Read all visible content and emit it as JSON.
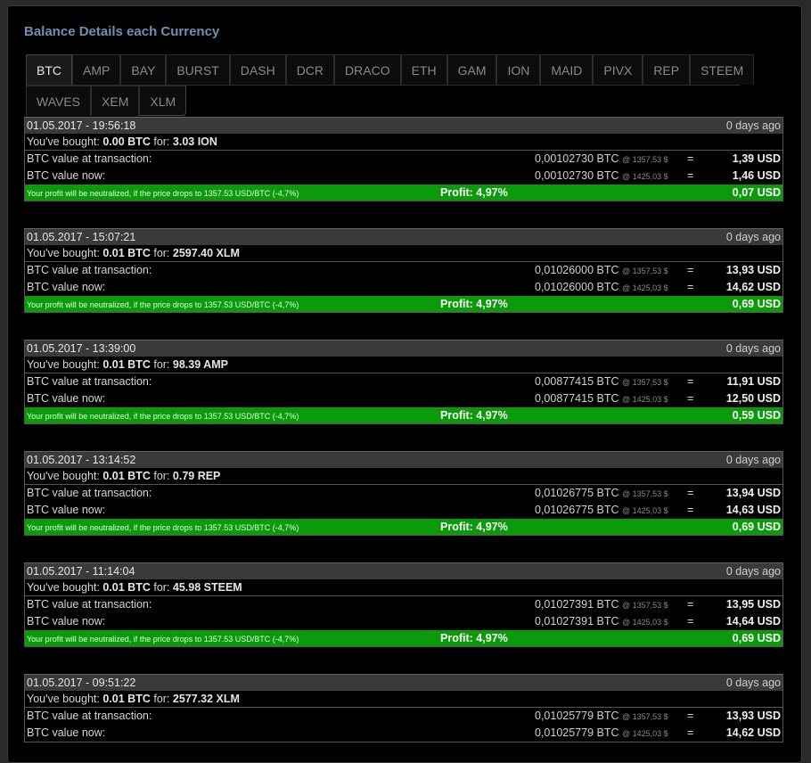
{
  "panel": {
    "title": "Balance Details each Currency"
  },
  "tabs": {
    "row1": [
      "BTC",
      "AMP",
      "BAY",
      "BURST",
      "DASH",
      "DCR",
      "DRACO",
      "ETH",
      "GAM",
      "ION",
      "MAID",
      "PIVX",
      "REP",
      "STEEM"
    ],
    "row2": [
      "WAVES",
      "XEM",
      "XLM"
    ],
    "active": "BTC"
  },
  "labels": {
    "bought_prefix": "You've bought:",
    "for": "for:",
    "value_at": "BTC value at transaction:",
    "value_now": "BTC value now:",
    "profit_note": "Your profit will be neutralized, if the price drops to 1357.53 USD/BTC (-4,7%)",
    "at_price_then": "@ 1357,53 $",
    "at_price_now": "@ 1425,03 $",
    "equals": "="
  },
  "transactions": [
    {
      "date": "01.05.2017 - 19:56:18",
      "ago": "0 days ago",
      "btc": "0.00 BTC",
      "amount": "3.03 ION",
      "btc_then": "0,00102730 BTC",
      "usd_then": "1,39 USD",
      "btc_now": "0,00102730 BTC",
      "usd_now": "1,46 USD",
      "profit_pct": "Profit: 4,97%",
      "profit_usd": "0,07 USD"
    },
    {
      "date": "01.05.2017 - 15:07:21",
      "ago": "0 days ago",
      "btc": "0.01 BTC",
      "amount": "2597.40 XLM",
      "btc_then": "0,01026000 BTC",
      "usd_then": "13,93 USD",
      "btc_now": "0,01026000 BTC",
      "usd_now": "14,62 USD",
      "profit_pct": "Profit: 4,97%",
      "profit_usd": "0,69 USD"
    },
    {
      "date": "01.05.2017 - 13:39:00",
      "ago": "0 days ago",
      "btc": "0.01 BTC",
      "amount": "98.39 AMP",
      "btc_then": "0,00877415 BTC",
      "usd_then": "11,91 USD",
      "btc_now": "0,00877415 BTC",
      "usd_now": "12,50 USD",
      "profit_pct": "Profit: 4,97%",
      "profit_usd": "0,59 USD"
    },
    {
      "date": "01.05.2017 - 13:14:52",
      "ago": "0 days ago",
      "btc": "0.01 BTC",
      "amount": "0.79 REP",
      "btc_then": "0,01026775 BTC",
      "usd_then": "13,94 USD",
      "btc_now": "0,01026775 BTC",
      "usd_now": "14,63 USD",
      "profit_pct": "Profit: 4,97%",
      "profit_usd": "0,69 USD"
    },
    {
      "date": "01.05.2017 - 11:14:04",
      "ago": "0 days ago",
      "btc": "0.01 BTC",
      "amount": "45.98 STEEM",
      "btc_then": "0,01027391 BTC",
      "usd_then": "13,95 USD",
      "btc_now": "0,01027391 BTC",
      "usd_now": "14,64 USD",
      "profit_pct": "Profit: 4,97%",
      "profit_usd": "0,69 USD"
    },
    {
      "date": "01.05.2017 - 09:51:22",
      "ago": "0 days ago",
      "btc": "0.01 BTC",
      "amount": "2577.32 XLM",
      "btc_then": "0,01025779 BTC",
      "usd_then": "13,93 USD",
      "btc_now": "0,01025779 BTC",
      "usd_now": "14,62 USD",
      "profit_pct": "",
      "profit_usd": ""
    }
  ]
}
